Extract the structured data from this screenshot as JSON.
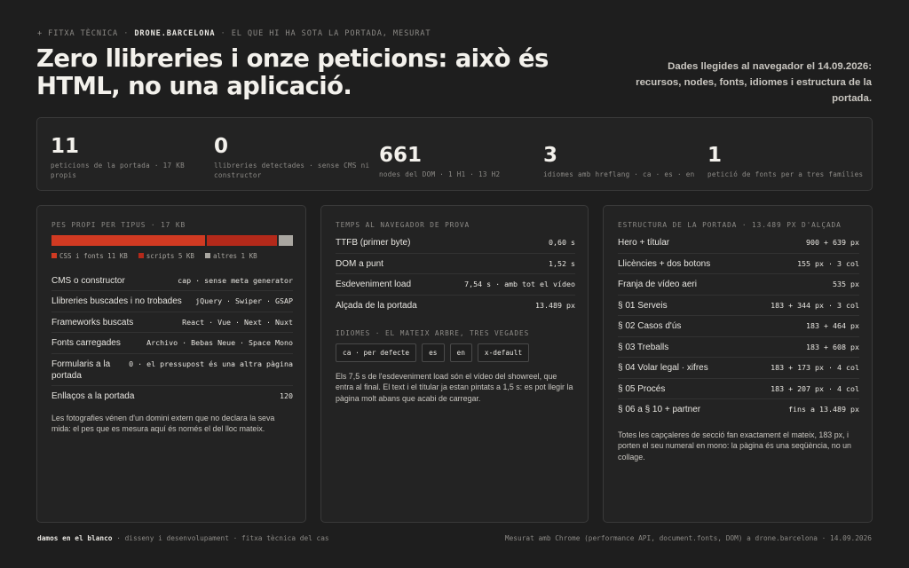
{
  "header": {
    "eyebrow_bullet": "+",
    "eyebrow_pre": "FITXA TÈCNICA",
    "eyebrow_brand": "DRONE.BARCELONA",
    "eyebrow_post": "EL QUE HI HA SOTA LA PORTADA, MESURAT",
    "title": "Zero llibreries i onze peticions: això és HTML, no una aplicació.",
    "note": "Dades llegides al navegador el 14.09.2026: recursos, nodes, fonts, idiomes i estructura de la portada."
  },
  "stats": [
    {
      "value": "11",
      "label": "peticions de la portada · 17 KB propis"
    },
    {
      "value": "0",
      "label": "llibreries detectades · sense CMS ni constructor"
    },
    {
      "value": "661",
      "label": "nodes del DOM · 1 H1 · 13 H2"
    },
    {
      "value": "3",
      "label": "idiomes amb hreflang · ca · es · en"
    },
    {
      "value": "1",
      "label": "petició de fonts per a tres famílies"
    }
  ],
  "weight": {
    "heading": "PES PROPI PER TIPUS · 17 KB",
    "segments": [
      {
        "label": "CSS i fonts 11 KB",
        "kb": 11,
        "color": "#d13a22"
      },
      {
        "label": "scripts 5 KB",
        "kb": 5,
        "color": "#b3291a"
      },
      {
        "label": "altres 1 KB",
        "kb": 1,
        "color": "#a9a6a0"
      }
    ],
    "rows": [
      {
        "k": "CMS o constructor",
        "v": "cap · sense meta generator"
      },
      {
        "k": "Llibreries buscades i no trobades",
        "v": "jQuery · Swiper · GSAP"
      },
      {
        "k": "Frameworks buscats",
        "v": "React · Vue · Next · Nuxt"
      },
      {
        "k": "Fonts carregades",
        "v": "Archivo · Bebas Neue · Space Mono"
      },
      {
        "k": "Formularis a la portada",
        "v": "0 · el pressupost és una altra pàgina"
      },
      {
        "k": "Enllaços a la portada",
        "v": "120"
      }
    ],
    "footnote": "Les fotografies vénen d'un domini extern que no declara la seva mida: el pes que es mesura aquí és només el del lloc mateix."
  },
  "timing": {
    "heading": "TEMPS AL NAVEGADOR DE PROVA",
    "rows": [
      {
        "k": "TTFB (primer byte)",
        "v": "0,60 s"
      },
      {
        "k": "DOM a punt",
        "v": "1,52 s"
      },
      {
        "k": "Esdeveniment load",
        "v": "7,54 s · amb tot el vídeo"
      },
      {
        "k": "Alçada de la portada",
        "v": "13.489 px"
      }
    ],
    "langs_heading": "IDIOMES · EL MATEIX ARBRE, TRES VEGADES",
    "langs": [
      "ca · per defecte",
      "es",
      "en",
      "x-default"
    ],
    "footnote": "Els 7,5 s de l'esdeveniment load són el vídeo del showreel, que entra al final. El text i el títular ja estan pintats a 1,5 s: es pot llegir la pàgina molt abans que acabi de carregar."
  },
  "structure": {
    "heading": "ESTRUCTURA DE LA PORTADA · 13.489 PX D'ALÇADA",
    "rows": [
      {
        "k": "Hero + títular",
        "v": "900 + 639 px"
      },
      {
        "k": "Llicències + dos botons",
        "v": "155 px · 3 col"
      },
      {
        "k": "Franja de vídeo aeri",
        "v": "535 px"
      },
      {
        "k": "§ 01 Serveis",
        "v": "183 + 344 px · 3 col"
      },
      {
        "k": "§ 02 Casos d'ús",
        "v": "183 + 464 px"
      },
      {
        "k": "§ 03 Treballs",
        "v": "183 + 608 px"
      },
      {
        "k": "§ 04 Volar legal · xifres",
        "v": "183 + 173 px · 4 col"
      },
      {
        "k": "§ 05 Procés",
        "v": "183 + 207 px · 4 col"
      },
      {
        "k": "§ 06 a § 10 + partner",
        "v": "fins a 13.489 px"
      }
    ],
    "footnote": "Totes les capçaleres de secció fan exactament el mateix, 183 px, i porten el seu numeral en mono: la pàgina és una seqüència, no un collage."
  },
  "footer": {
    "brand": "damos en el blanco",
    "left": "· disseny i desenvolupament · fitxa tècnica del cas",
    "right": "Mesurat amb Chrome (performance API, document.fonts, DOM) a drone.barcelona · 14.09.2026"
  }
}
